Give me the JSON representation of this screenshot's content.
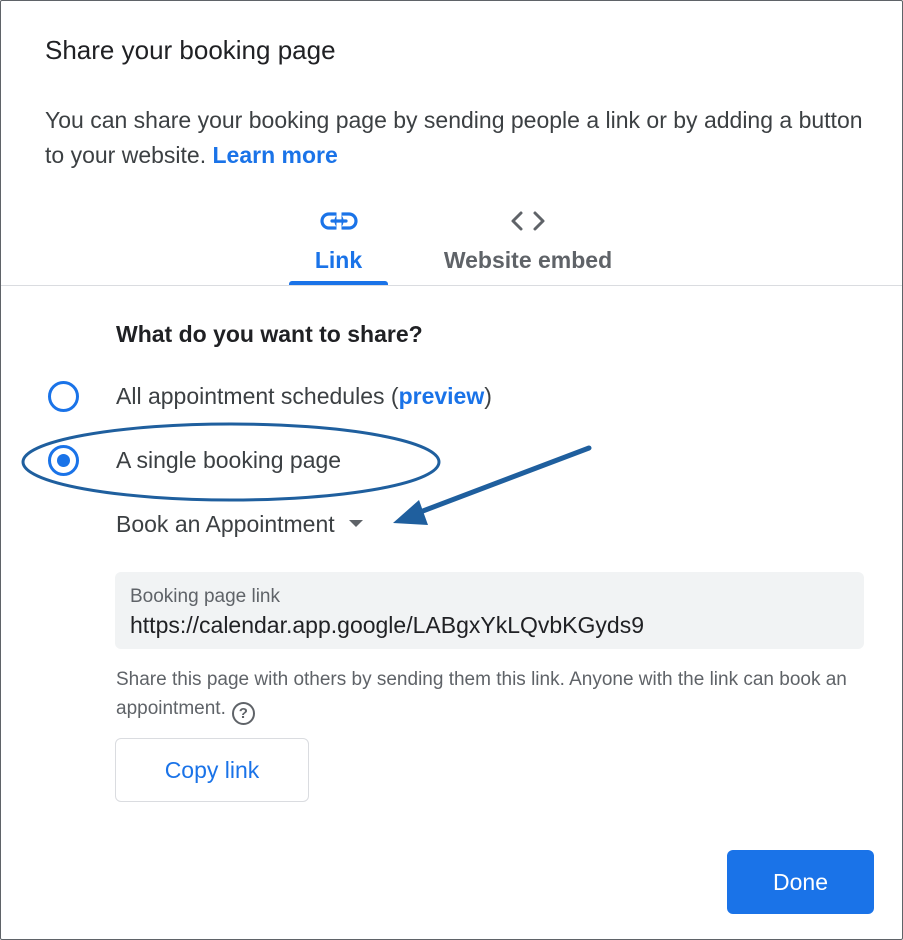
{
  "dialog": {
    "title": "Share your booking page",
    "description": "You can share your booking page by sending people a link or by adding a button to your website.",
    "learn_more": "Learn more"
  },
  "tabs": [
    {
      "label": "Link",
      "icon": "link-icon",
      "selected": true
    },
    {
      "label": "Website embed",
      "icon": "code-icon",
      "selected": false
    }
  ],
  "share": {
    "question": "What do you want to share?",
    "options": [
      {
        "label_prefix": "All appointment schedules (",
        "label_link": "preview",
        "label_suffix": ")",
        "selected": false
      },
      {
        "label": "A single booking page",
        "selected": true
      }
    ],
    "dropdown_value": "Book an Appointment"
  },
  "link_field": {
    "label": "Booking page link",
    "value": "https://calendar.app.google/LABgxYkLQvbKGyds9"
  },
  "help": {
    "text": "Share this page with others by sending them this link. Anyone with the link can book an appointment.",
    "icon": "help-icon",
    "icon_glyph": "?"
  },
  "buttons": {
    "copy_link": "Copy link",
    "done": "Done"
  },
  "colors": {
    "accent": "#1a73e8",
    "annotation": "#1f5f9e"
  }
}
